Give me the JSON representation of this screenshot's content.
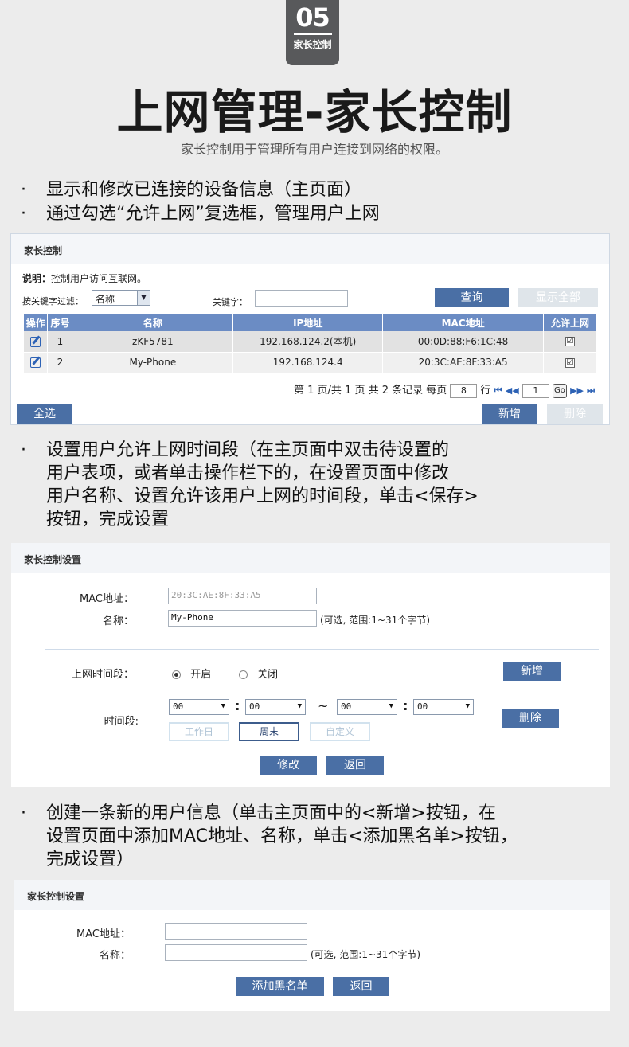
{
  "badge": {
    "number": "05",
    "label": "家长控制"
  },
  "title": "上网管理-家长控制",
  "subtitle": "家长控制用于管理所有用户连接到网络的权限。",
  "bullets": [
    "显示和修改已连接的设备信息（主页面）",
    "通过勾选“允许上网”复选框，管理用户上网",
    "设置用户允许上网时间段（在主页面中双击待设置的\n用户表项，或者单击操作栏下的，在设置页面中修改\n用户名称、设置允许该用户上网的时间段，单击<保存>\n按钮，完成设置",
    "创建一条新的用户信息（单击主页面中的<新增>按钮，在\n设置页面中添加MAC地址、名称，单击<添加黑名单>按钮，\n完成设置）"
  ],
  "panel1": {
    "header": "家长控制",
    "desc_bold": "说明：",
    "desc": "控制用户访问互联网。",
    "filter_label": "按关键字过滤：",
    "filter_value": "名称",
    "keyword_label": "关键字：",
    "keyword_value": "",
    "query_btn": "查询",
    "show_all_btn": "显示全部",
    "columns": [
      "操作",
      "序号",
      "名称",
      "IP地址",
      "MAC地址",
      "允许上网"
    ],
    "rows": [
      {
        "index": "1",
        "name": "zKF5781",
        "ip": "192.168.124.2(本机)",
        "mac": "00:0D:88:F6:1C:48",
        "allowed": "☑"
      },
      {
        "index": "2",
        "name": "My-Phone",
        "ip": "192.168.124.4",
        "mac": "20:3C:AE:8F:33:A5",
        "allowed": "☑"
      }
    ],
    "pager_text": "第 1 页/共 1 页 共 2 条记录 每页",
    "per_page": "8",
    "row_unit": "行",
    "page_input": "1",
    "go": "Go",
    "select_all_btn": "全选",
    "add_btn": "新增",
    "delete_btn": "删除"
  },
  "panel2": {
    "header": "家长控制设置",
    "mac_label": "MAC地址：",
    "mac_value": "20:3C:AE:8F:33:A5",
    "name_label": "名称：",
    "name_value": "My-Phone",
    "name_hint": "(可选, 范围:1~31个字节)",
    "period_label": "上网时间段：",
    "on_label": "开启",
    "off_label": "关闭",
    "add_btn": "新增",
    "time_label": "时间段:",
    "time_from_h": "00",
    "time_from_m": "00",
    "tilde": "~",
    "time_to_h": "00",
    "time_to_m": "00",
    "colon": ":",
    "workday": "工作日",
    "weekend": "周末",
    "custom": "自定义",
    "delete_btn": "删除",
    "modify_btn": "修改",
    "back_btn": "返回"
  },
  "panel3": {
    "header": "家长控制设置",
    "mac_label": "MAC地址：",
    "mac_value": "",
    "name_label": "名称：",
    "name_value": "",
    "name_hint": "(可选, 范围:1~31个字节)",
    "blacklist_btn": "添加黑名单",
    "back_btn": "返回"
  }
}
